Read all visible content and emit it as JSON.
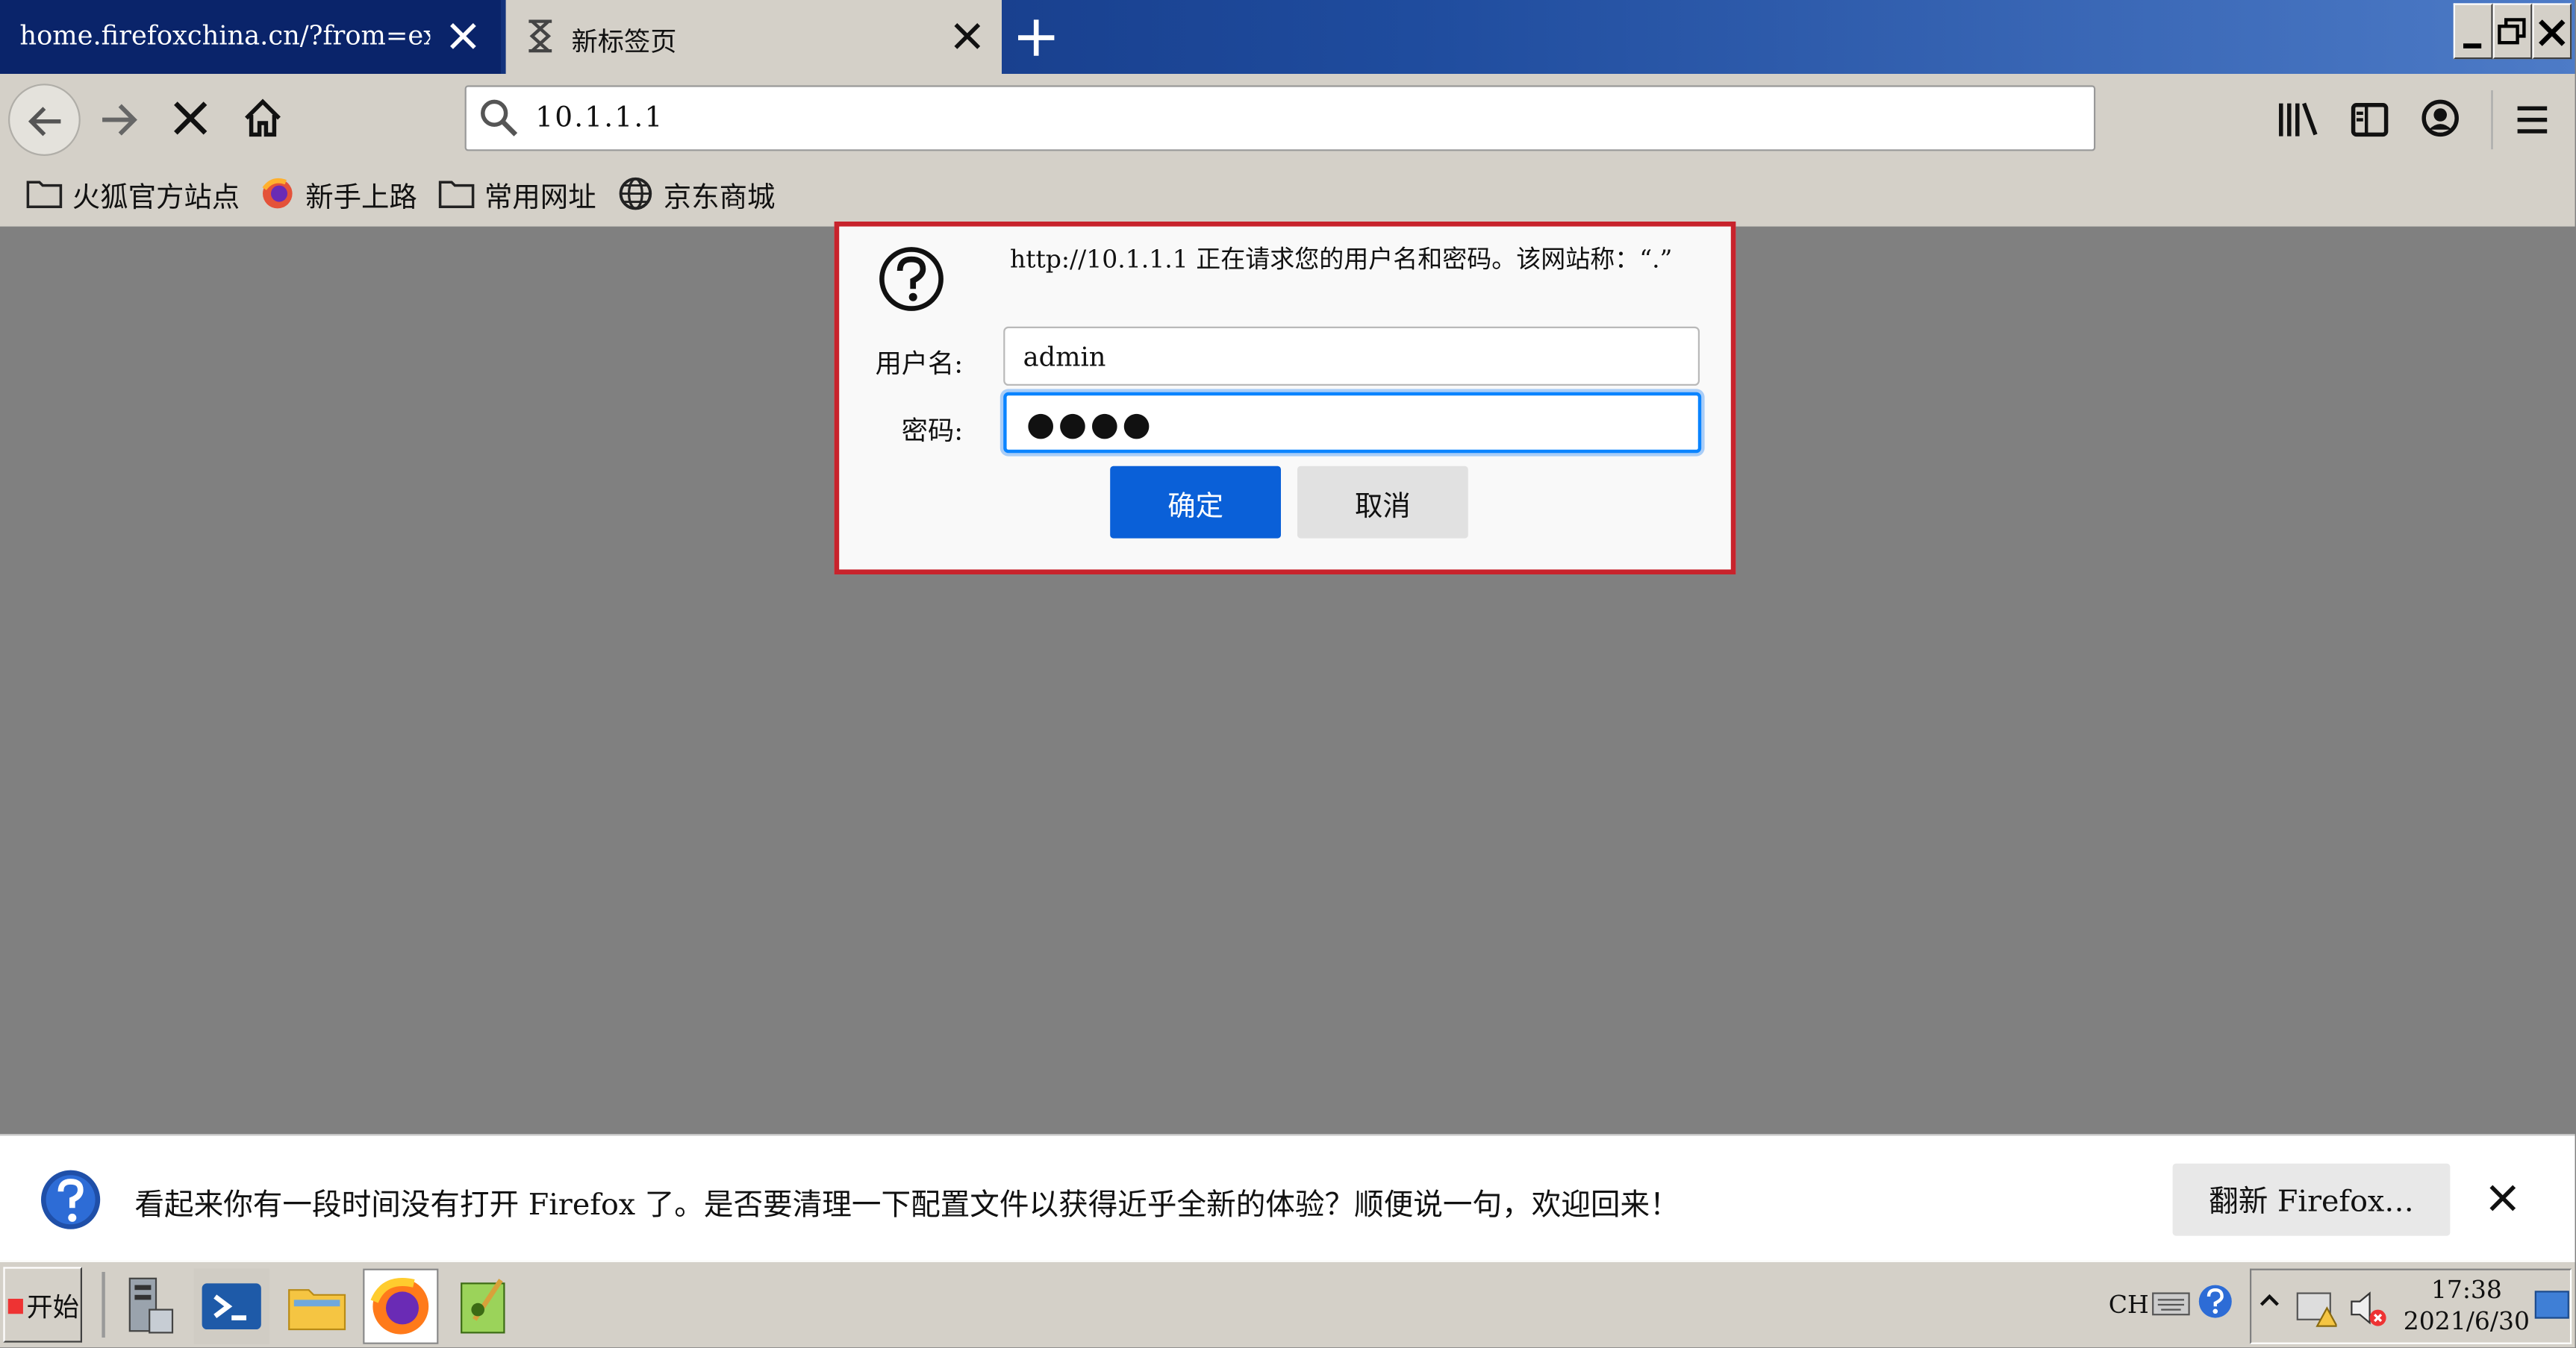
{
  "browser": {
    "tabs": [
      {
        "label": "home.firefoxchina.cn/?from=extra_start"
      },
      {
        "label": "新标签页"
      }
    ]
  },
  "navbar": {
    "url": "10.1.1.1"
  },
  "bookmarks": [
    {
      "label": "火狐官方站点",
      "icon": "folder-icon"
    },
    {
      "label": "新手上路",
      "icon": "firefox-icon"
    },
    {
      "label": "常用网址",
      "icon": "folder-icon"
    },
    {
      "label": "京东商城",
      "icon": "globe-icon"
    }
  ],
  "auth_dialog": {
    "message": "http://10.1.1.1 正在请求您的用户名和密码。该网站称：“.”",
    "username_label": "用户名:",
    "username_value": "admin",
    "password_label": "密码:",
    "password_value": "●●●●",
    "ok_label": "确定",
    "cancel_label": "取消"
  },
  "notification": {
    "text": "看起来你有一段时间没有打开 Firefox 了。是否要清理一下配置文件以获得近乎全新的体验？顺便说一句，欢迎回来！",
    "button_label": "翻新 Firefox…"
  },
  "taskbar": {
    "start_label": "开始",
    "lang": "CH",
    "time": "17:38",
    "date": "2021/6/30"
  },
  "colors": {
    "accent_blue": "#0a60d8",
    "dialog_highlight": "#c8232c",
    "titlebar": "#0a246a"
  }
}
